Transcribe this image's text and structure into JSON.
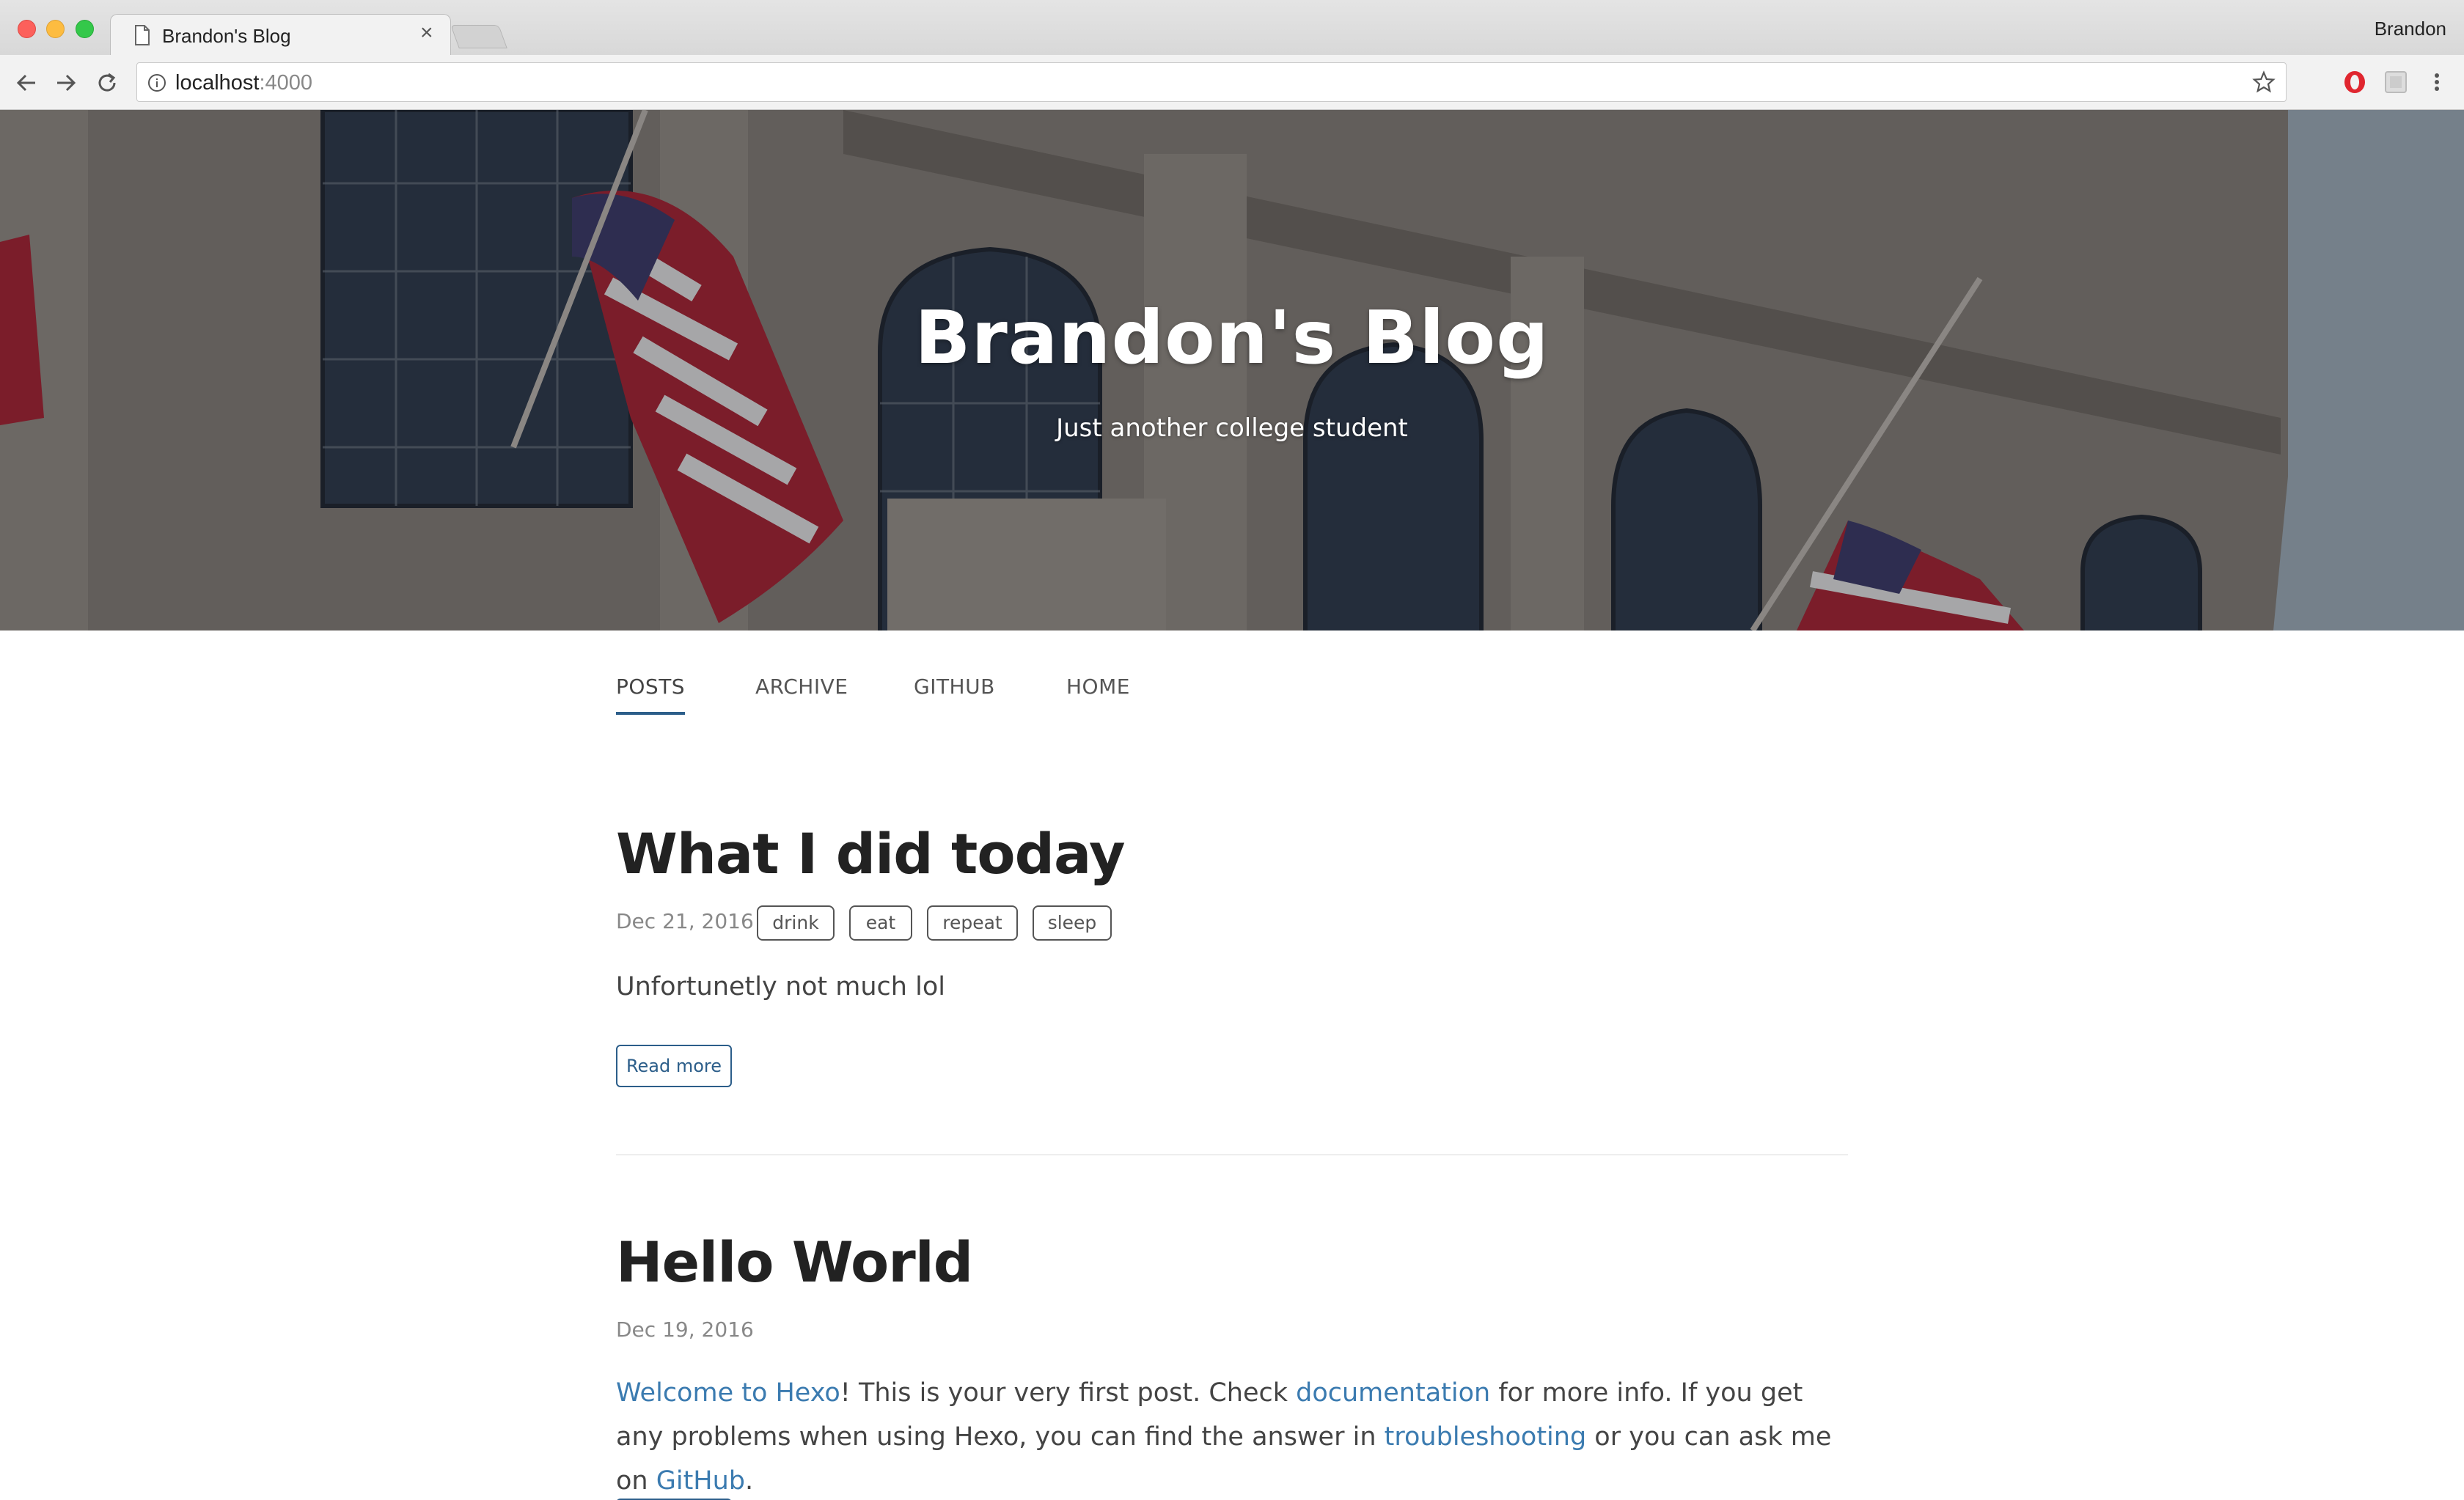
{
  "browser": {
    "tab_title": "Brandon's Blog",
    "tab_close": "×",
    "profile_name": "Brandon",
    "url_host": "localhost",
    "url_port": ":4000"
  },
  "hero": {
    "title": "Brandon's Blog",
    "subtitle": "Just another college student"
  },
  "nav": {
    "items": [
      {
        "label": "POSTS",
        "active": true
      },
      {
        "label": "ARCHIVE",
        "active": false
      },
      {
        "label": "GITHUB",
        "active": false
      },
      {
        "label": "HOME",
        "active": false
      }
    ]
  },
  "posts": [
    {
      "title": "What I did today",
      "date": "Dec 21, 2016",
      "tags": [
        "drink",
        "eat",
        "repeat",
        "sleep"
      ],
      "excerpt": "Unfortunetly not much lol",
      "read_more": "Read more"
    },
    {
      "title": "Hello World",
      "date": "Dec 19, 2016",
      "excerpt_parts": {
        "link1": "Welcome to Hexo",
        "text1": "! This is your very first post. Check ",
        "link2": "documentation",
        "text2": " for more info. If you get any problems when using Hexo, you can find the answer in ",
        "link3": "troubleshooting",
        "text3": " or you can ask me on ",
        "link4": "GitHub",
        "text4": "."
      }
    }
  ],
  "colors": {
    "accent": "#2c5e8a",
    "link": "#3b7bb0",
    "title": "#222222"
  },
  "icons": [
    "document-icon",
    "back-arrow-icon",
    "forward-arrow-icon",
    "reload-icon",
    "info-icon",
    "star-icon",
    "opera-icon",
    "extension-icon",
    "menu-dots-icon"
  ]
}
